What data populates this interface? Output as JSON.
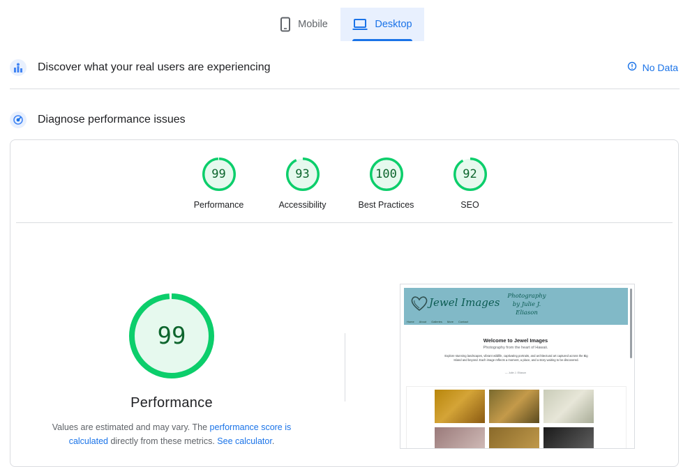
{
  "tabs": [
    {
      "label": "Mobile",
      "icon": "phone-icon",
      "selected": false
    },
    {
      "label": "Desktop",
      "icon": "laptop-icon",
      "selected": true
    }
  ],
  "field_data": {
    "title": "Discover what your real users are experiencing",
    "status": "No Data"
  },
  "lab_data": {
    "title": "Diagnose performance issues"
  },
  "scores": [
    {
      "label": "Performance",
      "value": "99"
    },
    {
      "label": "Accessibility",
      "value": "93"
    },
    {
      "label": "Best Practices",
      "value": "100"
    },
    {
      "label": "SEO",
      "value": "92"
    }
  ],
  "main_score": {
    "value": "99",
    "label": "Performance"
  },
  "note": {
    "part1": "Values are estimated and may vary. The ",
    "link1": "performance score is calculated",
    "part2": " directly from these metrics. ",
    "link2": "See calculator",
    "part3": "."
  },
  "preview": {
    "logo": "Jewel Images",
    "tagline": "Photography by Julie J. Eliason",
    "nav": [
      "Home",
      "About",
      "Galleries",
      "More",
      "Contact"
    ],
    "welcome": "Welcome to Jewel Images",
    "subtitle": "Photography from the heart of Hawaii.",
    "body": "Explore stunning landscapes, vibrant wildlife, captivating portraits, and architectural art captured across the Big Island and beyond. Each image reflects a moment, a place, and a story waiting to be discovered.",
    "signature": "— Julie J. Eliason"
  },
  "colors": {
    "pass": "#0cce6b",
    "pass_text": "#0d652d",
    "pass_bg": "#e6f9ee",
    "link": "#1a73e8"
  }
}
